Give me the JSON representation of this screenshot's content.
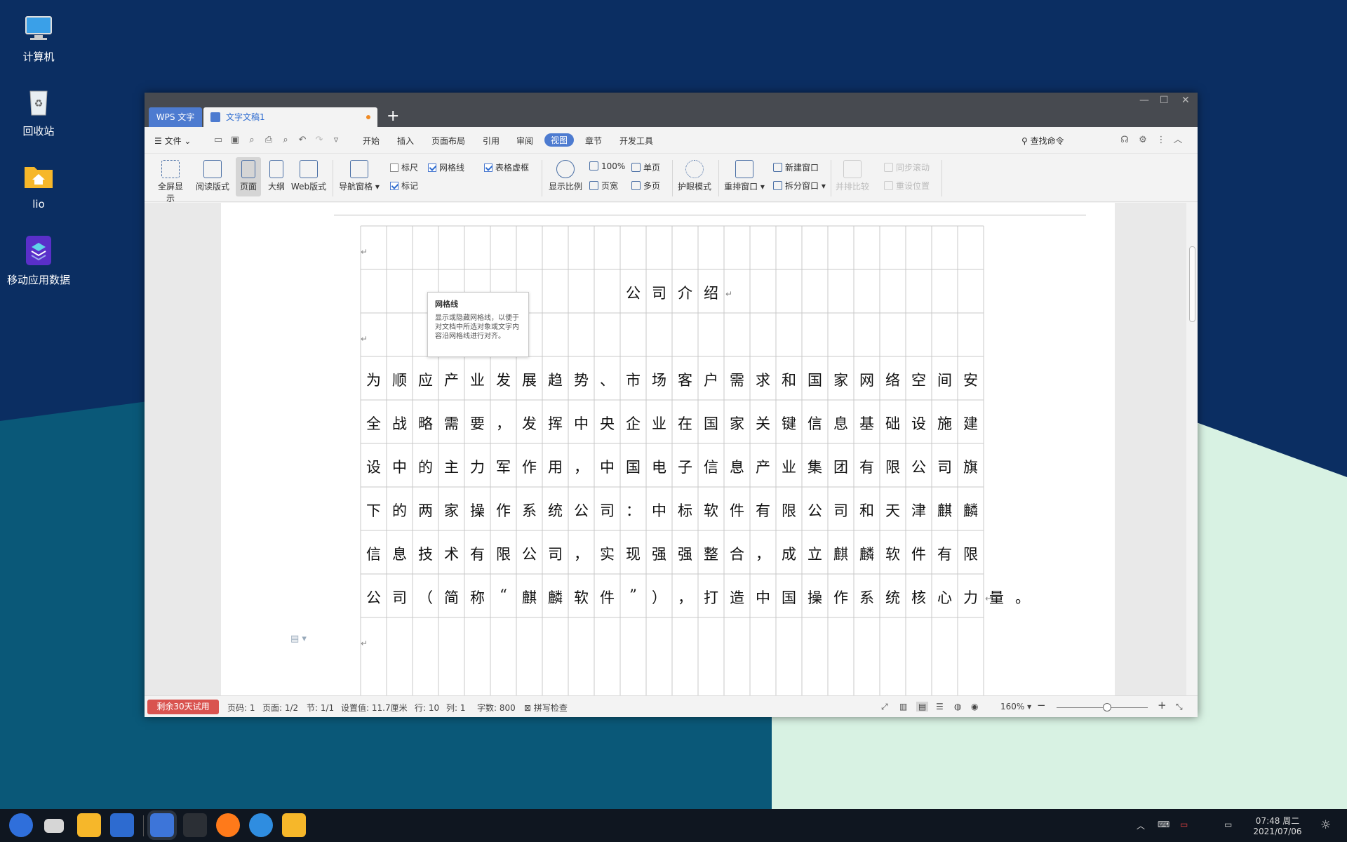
{
  "desktop": {
    "icons": [
      {
        "label": "计算机",
        "icon": "computer-icon"
      },
      {
        "label": "回收站",
        "icon": "trash-icon"
      },
      {
        "label": "lio",
        "icon": "home-folder-icon"
      },
      {
        "label": "移动应用数据",
        "icon": "mobile-data-icon"
      }
    ],
    "colors": {
      "top": "#0b2e62",
      "teal": "#0a5878",
      "mint": "#d8f2e3"
    }
  },
  "window": {
    "tabs": {
      "app": "WPS 文字",
      "doc": "文字文稿1",
      "new": "+"
    },
    "controls": {
      "min": "—",
      "max": "☐",
      "close": "✕"
    }
  },
  "menubar": {
    "file": "文件",
    "items": [
      "开始",
      "插入",
      "页面布局",
      "引用",
      "审阅",
      "视图",
      "章节",
      "开发工具"
    ],
    "active": "视图",
    "search": "查找命令"
  },
  "ribbon": {
    "big": [
      {
        "label": "全屏显示",
        "icon": "fullscreen-icon"
      },
      {
        "label": "阅读版式",
        "icon": "read-mode-icon"
      },
      {
        "label": "页面",
        "icon": "page-view-icon"
      },
      {
        "label": "大纲",
        "icon": "outline-icon"
      },
      {
        "label": "Web版式",
        "icon": "web-layout-icon"
      },
      {
        "label": "导航窗格",
        "icon": "nav-pane-icon"
      },
      {
        "label": "显示比例",
        "icon": "zoom-icon"
      },
      {
        "label": "护眼模式",
        "icon": "eye-care-icon"
      },
      {
        "label": "重排窗口",
        "icon": "arrange-window-icon"
      },
      {
        "label": "并排比较",
        "icon": "compare-icon"
      }
    ],
    "checks": [
      {
        "label": "标尺",
        "checked": false
      },
      {
        "label": "网格线",
        "checked": true
      },
      {
        "label": "表格虚框",
        "checked": true
      },
      {
        "label": "标记",
        "checked": true
      }
    ],
    "small": {
      "zoom100": "100%",
      "single": "单页",
      "pagewidth": "页宽",
      "multi": "多页",
      "newwin": "新建窗口",
      "split": "拆分窗口",
      "syncscroll": "同步滚动",
      "resetpos": "重设位置"
    }
  },
  "tooltip": {
    "title": "网格线",
    "text": "显示或隐藏网格线，以便于对文档中所选对象或文字内容沿网格线进行对齐。"
  },
  "document": {
    "title": [
      "公",
      "司",
      "介",
      "绍"
    ],
    "lines": [
      "为顺应产业发展趋势、市场客户需求和国家网络空间安",
      "全战略需要，发挥中央企业在国家关键信息基础设施建",
      "设中的主力军作用，中国电子信息产业集团有限公司旗",
      "下的两家操作系统公司：中标软件有限公司和天津麒麟",
      "信息技术有限公司，实现强强整合，成立麒麟软件有限",
      "公司（简称“麒麟软件”），打造中国操作系统核心力量。"
    ],
    "return_mark": "↵"
  },
  "statusbar": {
    "trial": "剩余30天试用",
    "pagecode": "页码: 1",
    "pages": "页面: 1/2",
    "section": "节: 1/1",
    "setting": "设置值: 11.7厘米",
    "row": "行: 10",
    "col": "列: 1",
    "words": "字数: 800",
    "spell": "拼写检查",
    "zoom": "160%"
  },
  "taskbar": {
    "time": "07:48 周二",
    "date": "2021/07/06"
  }
}
